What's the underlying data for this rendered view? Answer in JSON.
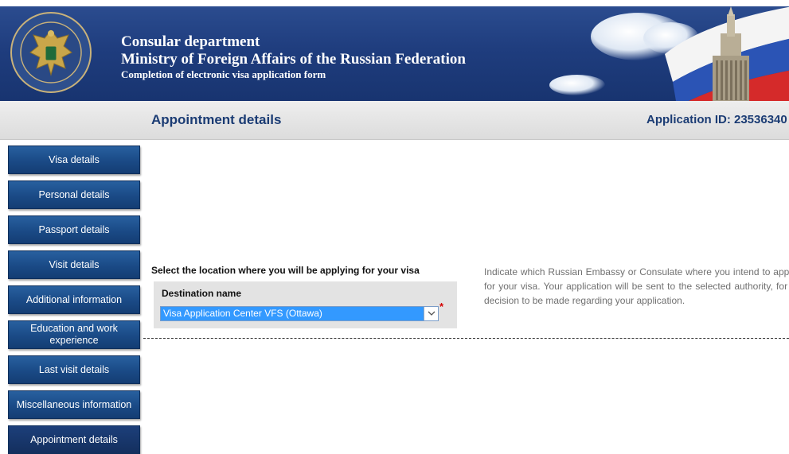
{
  "header": {
    "line1": "Consular department",
    "line2": "Ministry of Foreign Affairs of the Russian Federation",
    "line3": "Completion of electronic visa application form"
  },
  "titlebar": {
    "page_title": "Appointment details",
    "application_id": "Application ID: 23536340"
  },
  "sidebar": {
    "items": [
      {
        "label": "Visa details"
      },
      {
        "label": "Personal details"
      },
      {
        "label": "Passport details"
      },
      {
        "label": "Visit details"
      },
      {
        "label": "Additional information"
      },
      {
        "label": "Education and work experience"
      },
      {
        "label": "Last visit details"
      },
      {
        "label": "Miscellaneous information"
      },
      {
        "label": "Appointment details",
        "active": true
      }
    ]
  },
  "main": {
    "select_prompt": "Select the location where you will be applying for your visa",
    "destination_label": "Destination name",
    "destination_value": "Visa Application Center VFS (Ottawa)",
    "required_marker": "*",
    "help_text": "Indicate which Russian Embassy or Consulate where you intend to apply for your visa. Your application will be sent to the selected authority, for a decision to be made regarding your application."
  },
  "colors": {
    "banner_blue": "#1f3d7e",
    "nav_blue": "#1a4a86",
    "title_blue": "#1b3c74",
    "select_highlight": "#3399ff",
    "required_red": "#d40000"
  }
}
